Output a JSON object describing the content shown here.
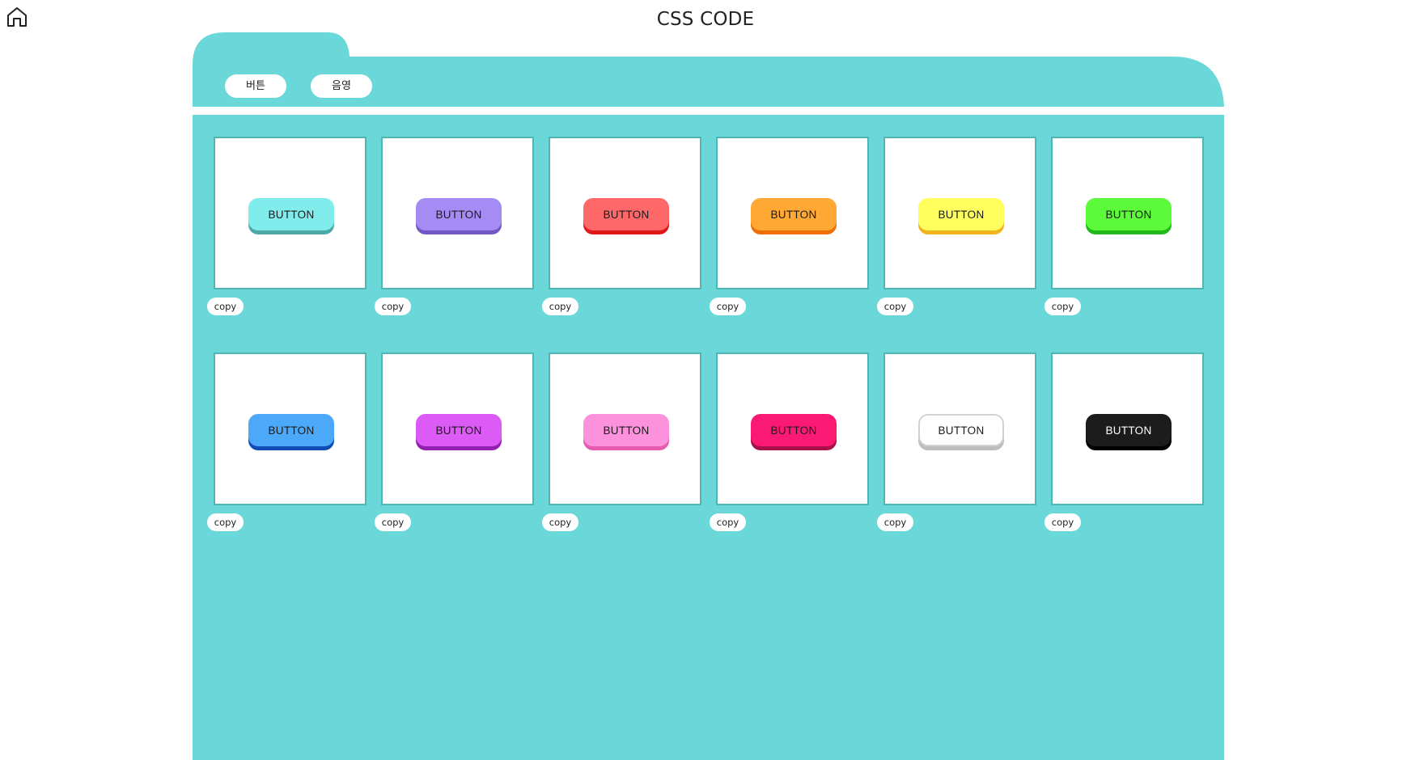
{
  "header": {
    "title": "CSS CODE",
    "home_icon": "home-icon"
  },
  "colors": {
    "panel": "#6AD8D8",
    "card_border": "#4FB6B4",
    "background": "#FFFFFF"
  },
  "tabs": [
    {
      "label": "버튼"
    },
    {
      "label": "음영"
    }
  ],
  "cards": [
    {
      "label": "BUTTON",
      "copy": "copy",
      "bg": "#80ECEC",
      "shadow": "#4DA8A8",
      "text": "#1a1a1a",
      "border": ""
    },
    {
      "label": "BUTTON",
      "copy": "copy",
      "bg": "#A48CF4",
      "shadow": "#7256C4",
      "text": "#1a1a1a",
      "border": ""
    },
    {
      "label": "BUTTON",
      "copy": "copy",
      "bg": "#FF6868",
      "shadow": "#E01818",
      "text": "#1a1a1a",
      "border": ""
    },
    {
      "label": "BUTTON",
      "copy": "copy",
      "bg": "#FFA834",
      "shadow": "#EE6E0A",
      "text": "#1a1a1a",
      "border": ""
    },
    {
      "label": "BUTTON",
      "copy": "copy",
      "bg": "#FFFF5E",
      "shadow": "#F2B41E",
      "text": "#1a1a1a",
      "border": ""
    },
    {
      "label": "BUTTON",
      "copy": "copy",
      "bg": "#5CFA3A",
      "shadow": "#22B81C",
      "text": "#1a1a1a",
      "border": ""
    },
    {
      "label": "BUTTON",
      "copy": "copy",
      "bg": "#4CA8F8",
      "shadow": "#0E4CB6",
      "text": "#1a1a1a",
      "border": ""
    },
    {
      "label": "BUTTON",
      "copy": "copy",
      "bg": "#DC5AF6",
      "shadow": "#9220B2",
      "text": "#1a1a1a",
      "border": ""
    },
    {
      "label": "BUTTON",
      "copy": "copy",
      "bg": "#FC92DC",
      "shadow": "#E65AB0",
      "text": "#1a1a1a",
      "border": ""
    },
    {
      "label": "BUTTON",
      "copy": "copy",
      "bg": "#FA1A74",
      "shadow": "#A8104C",
      "text": "#1a1a1a",
      "border": ""
    },
    {
      "label": "BUTTON",
      "copy": "copy",
      "bg": "#FFFFFF",
      "shadow": "#BDBDBD",
      "text": "#1a1a1a",
      "border": "#D2D2D2"
    },
    {
      "label": "BUTTON",
      "copy": "copy",
      "bg": "#1C1C1C",
      "shadow": "#000000",
      "text": "#FFFFFF",
      "border": ""
    }
  ]
}
